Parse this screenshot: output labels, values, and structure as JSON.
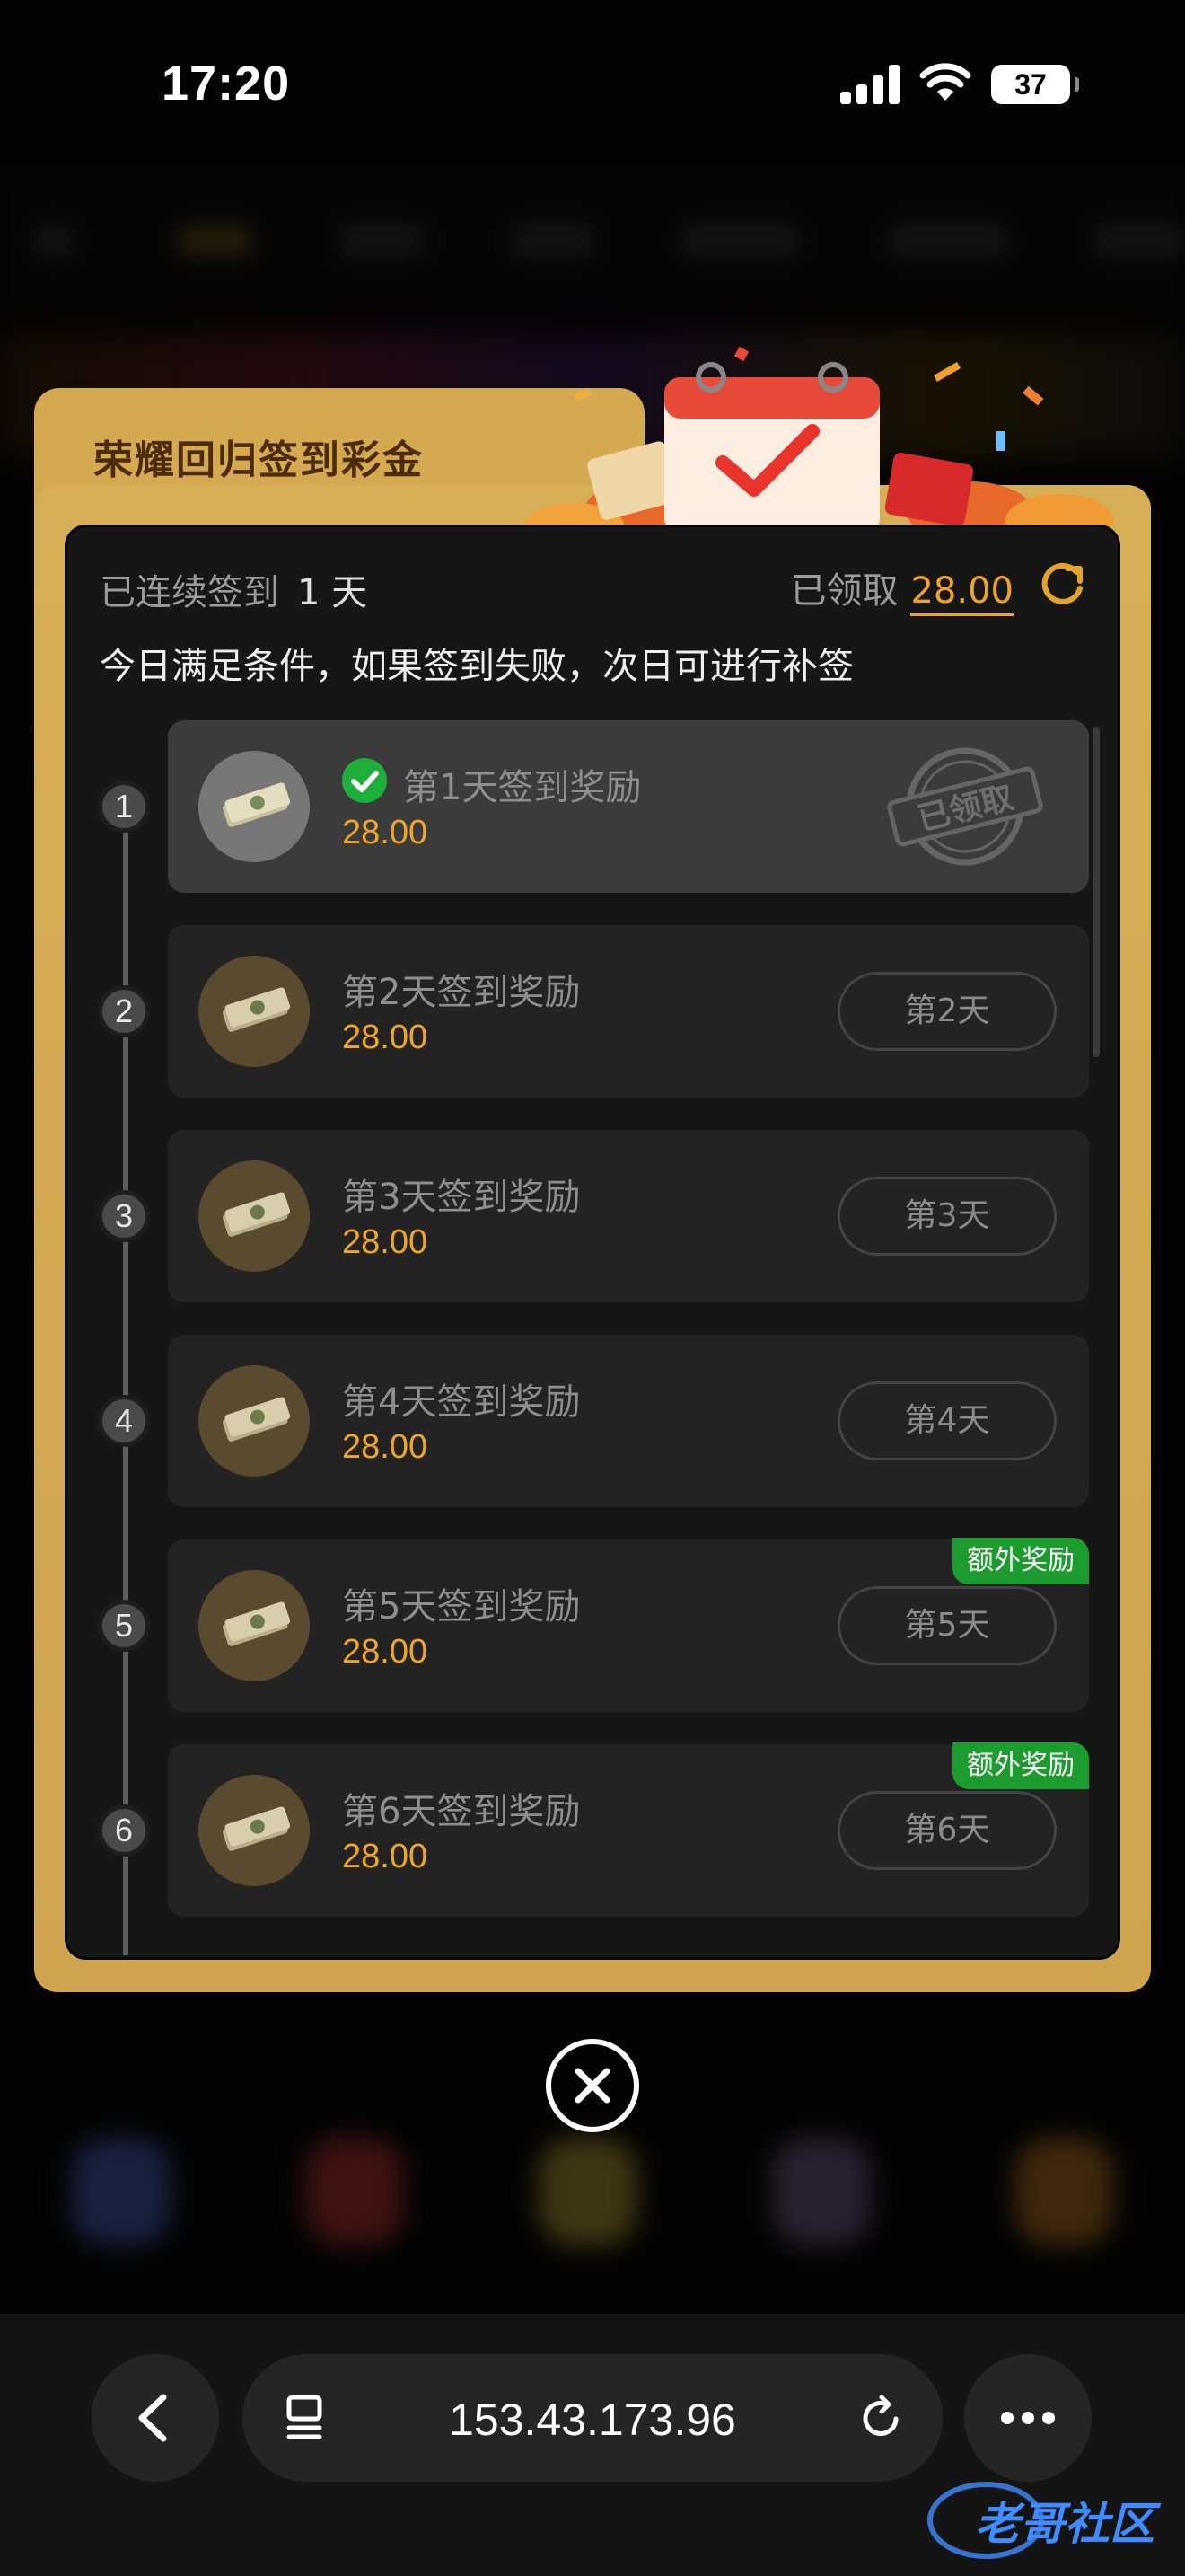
{
  "status_bar": {
    "time": "17:20",
    "battery": "37"
  },
  "modal": {
    "title": "荣耀回归签到彩金",
    "streak_label": "已连续签到",
    "streak_value": "1 天",
    "claimed_label": "已领取",
    "claimed_value": "28.00",
    "notice": "今日满足条件，如果签到失败，次日可进行补签",
    "stamp_text": "已领取",
    "rows": [
      {
        "num": "1",
        "title": "第1天签到奖励",
        "value": "28.00",
        "state": "claimed"
      },
      {
        "num": "2",
        "title": "第2天签到奖励",
        "value": "28.00",
        "button": "第2天"
      },
      {
        "num": "3",
        "title": "第3天签到奖励",
        "value": "28.00",
        "button": "第3天"
      },
      {
        "num": "4",
        "title": "第4天签到奖励",
        "value": "28.00",
        "button": "第4天"
      },
      {
        "num": "5",
        "title": "第5天签到奖励",
        "value": "28.00",
        "button": "第5天",
        "badge": "额外奖励"
      },
      {
        "num": "6",
        "title": "第6天签到奖励",
        "value": "28.00",
        "button": "第6天",
        "badge": "额外奖励"
      }
    ]
  },
  "browser": {
    "url": "153.43.173.96"
  },
  "watermark": {
    "text": "老哥社区"
  },
  "colors": {
    "gold": "#d4a94f",
    "accent_orange": "#f0a52a",
    "badge_green": "#1c9b2e",
    "check_green": "#1eaf3b"
  }
}
